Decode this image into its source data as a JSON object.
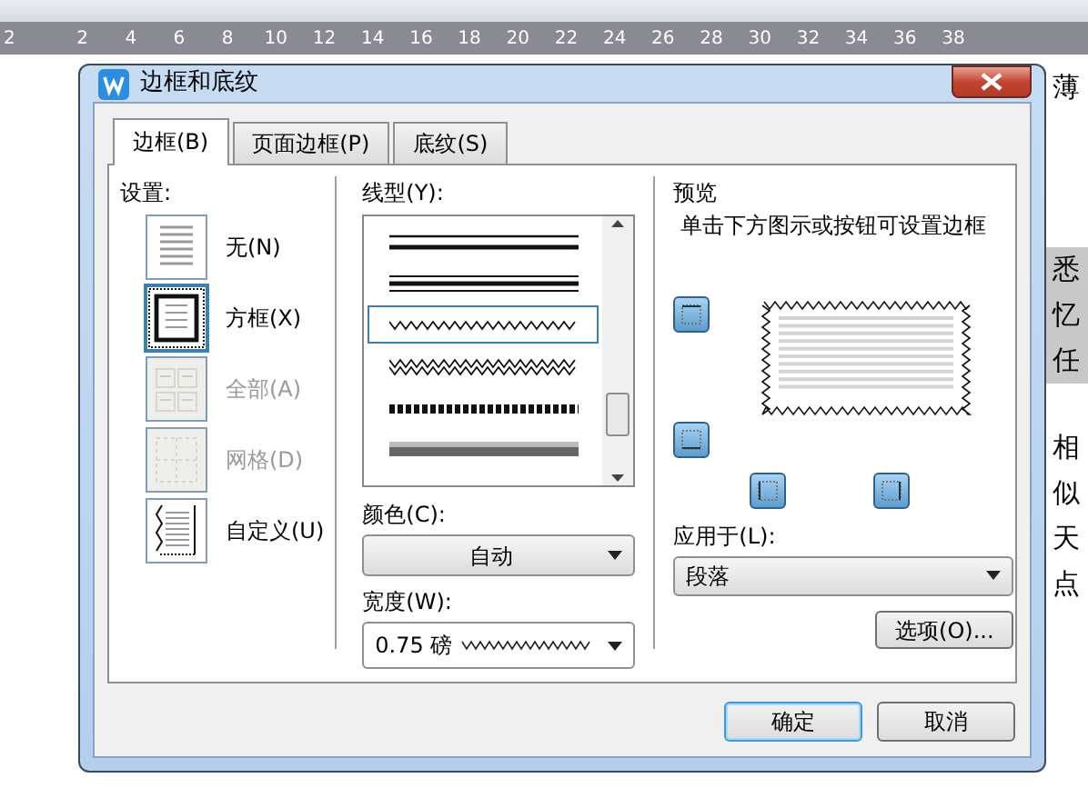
{
  "ruler": {
    "ticks": [
      "2",
      "2",
      "4",
      "6",
      "8",
      "10",
      "12",
      "14",
      "16",
      "18",
      "20",
      "22",
      "24",
      "26",
      "28",
      "30",
      "32",
      "34",
      "36",
      "38"
    ]
  },
  "document": {
    "right_chars": [
      {
        "text": "薄",
        "highlighted": false
      },
      {
        "text": "悉",
        "highlighted": true
      },
      {
        "text": "忆",
        "highlighted": true
      },
      {
        "text": "任",
        "highlighted": true
      },
      {
        "text": "相",
        "highlighted": false
      },
      {
        "text": "似",
        "highlighted": false
      },
      {
        "text": "天",
        "highlighted": false
      },
      {
        "text": "点",
        "highlighted": false
      }
    ]
  },
  "dialog": {
    "title": "边框和底纹",
    "tabs": [
      {
        "label": "边框(B)",
        "selected": true
      },
      {
        "label": "页面边框(P)",
        "selected": false
      },
      {
        "label": "底纹(S)",
        "selected": false
      }
    ],
    "settings": {
      "label": "设置:",
      "items": [
        {
          "label": "无(N)",
          "kind": "none",
          "selected": false,
          "disabled": false
        },
        {
          "label": "方框(X)",
          "kind": "box",
          "selected": true,
          "disabled": false
        },
        {
          "label": "全部(A)",
          "kind": "all",
          "selected": false,
          "disabled": true
        },
        {
          "label": "网格(D)",
          "kind": "grid",
          "selected": false,
          "disabled": true
        },
        {
          "label": "自定义(U)",
          "kind": "custom",
          "selected": false,
          "disabled": false
        }
      ]
    },
    "line_style": {
      "label": "线型(Y):",
      "items": [
        {
          "kind": "double",
          "selected": false
        },
        {
          "kind": "thick-thin",
          "selected": false
        },
        {
          "kind": "wavy",
          "selected": true
        },
        {
          "kind": "double-wavy",
          "selected": false
        },
        {
          "kind": "dashed-thick",
          "selected": false
        },
        {
          "kind": "gray-thick",
          "selected": false
        }
      ]
    },
    "color": {
      "label": "颜色(C):",
      "value": "自动"
    },
    "width": {
      "label": "宽度(W):",
      "value": "0.75 磅"
    },
    "preview": {
      "label": "预览",
      "hint": "单击下方图示或按钮可设置边框"
    },
    "apply_to": {
      "label": "应用于(L):",
      "value": "段落"
    },
    "options_button": "选项(O)...",
    "buttons": [
      {
        "label": "确定",
        "default": true
      },
      {
        "label": "取消",
        "default": false
      }
    ]
  }
}
